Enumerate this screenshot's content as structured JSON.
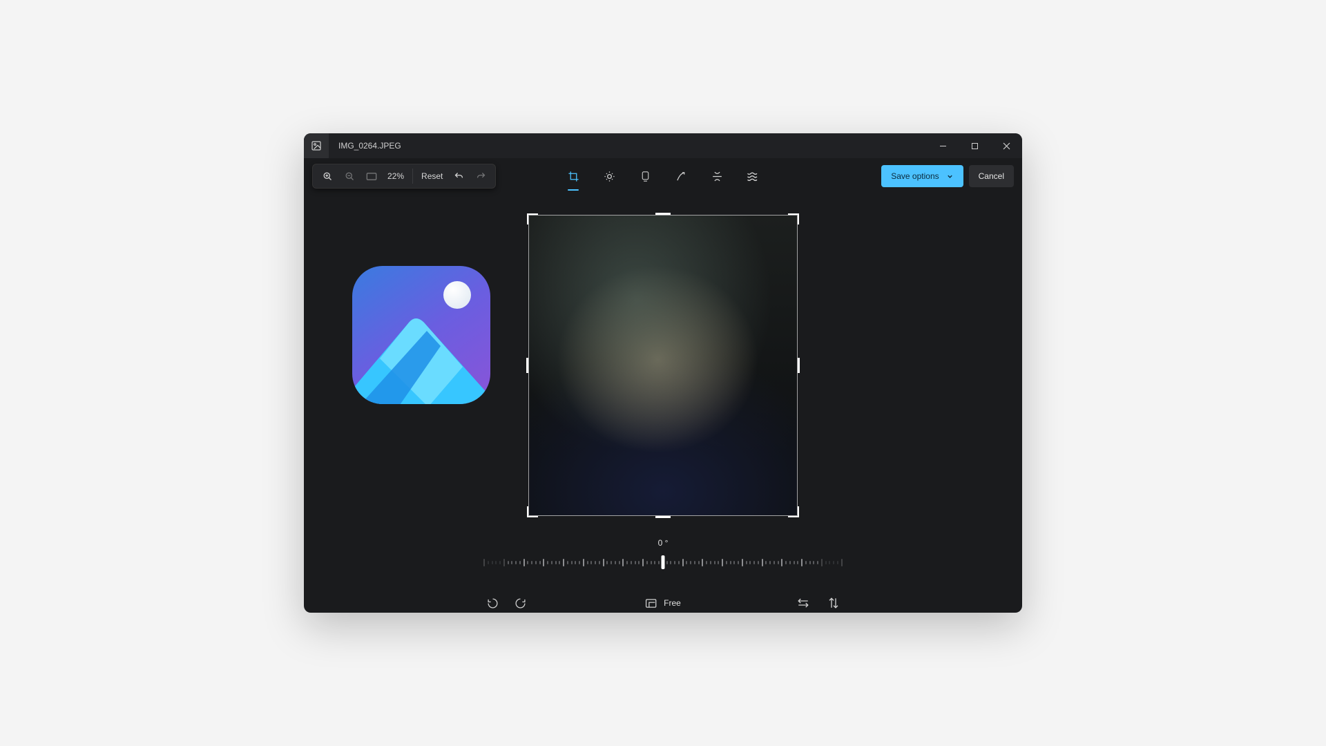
{
  "title_bar": {
    "file_name": "IMG_0264.JPEG"
  },
  "toolbar": {
    "zoom_percent": "22%",
    "reset_label": "Reset"
  },
  "actions": {
    "save_label": "Save options",
    "cancel_label": "Cancel"
  },
  "rotation": {
    "angle_label": "0 °"
  },
  "bottom": {
    "aspect_label": "Free"
  }
}
